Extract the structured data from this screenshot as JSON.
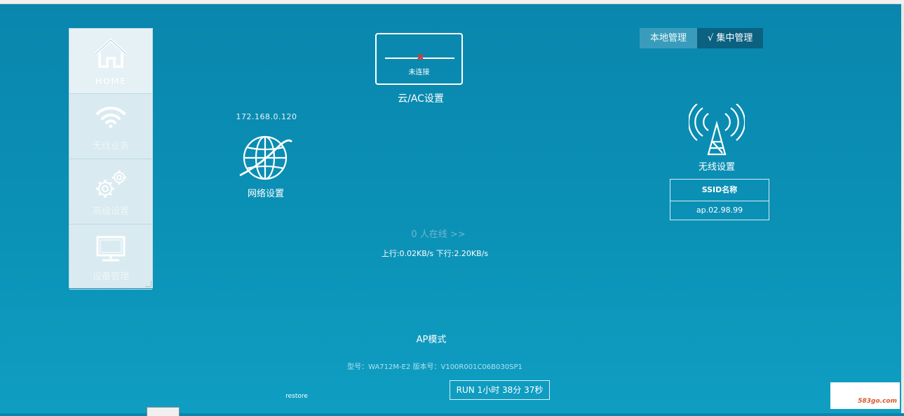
{
  "sidebar": {
    "items": [
      {
        "label": "HOME",
        "icon": "home-icon"
      },
      {
        "label": "无线业务",
        "icon": "wifi-icon"
      },
      {
        "label": "高级设置",
        "icon": "gears-icon"
      },
      {
        "label": "设备管理",
        "icon": "monitor-icon"
      }
    ]
  },
  "management": {
    "local_label": "本地管理",
    "central_label": "√ 集中管理"
  },
  "cloud": {
    "status": "未连接",
    "label": "云/AC设置"
  },
  "network": {
    "ip": "172.168.0.120",
    "label": "网络设置",
    "icon": "globe-icon"
  },
  "wireless": {
    "label": "无线设置",
    "icon": "antenna-tower-icon",
    "ssid_header": "SSID名称",
    "ssid_value": "ap.02.98.99"
  },
  "stats": {
    "online": "0 人在线 >>",
    "traffic": "上行:0.02KB/s  下行:2.20KB/s"
  },
  "device": {
    "mode": "AP模式",
    "model_info": "型号：WA712M-E2  版本号：V100R001C06B030SP1",
    "runtime": "RUN 1小时 38分 37秒",
    "restore": "restore"
  },
  "watermark": {
    "text": "583go.com"
  },
  "colors": {
    "background": "#0b8db3",
    "sidebar": "#d9ebf1",
    "central_active": "#0b6180",
    "disconnect_mark": "#d43a3a"
  }
}
